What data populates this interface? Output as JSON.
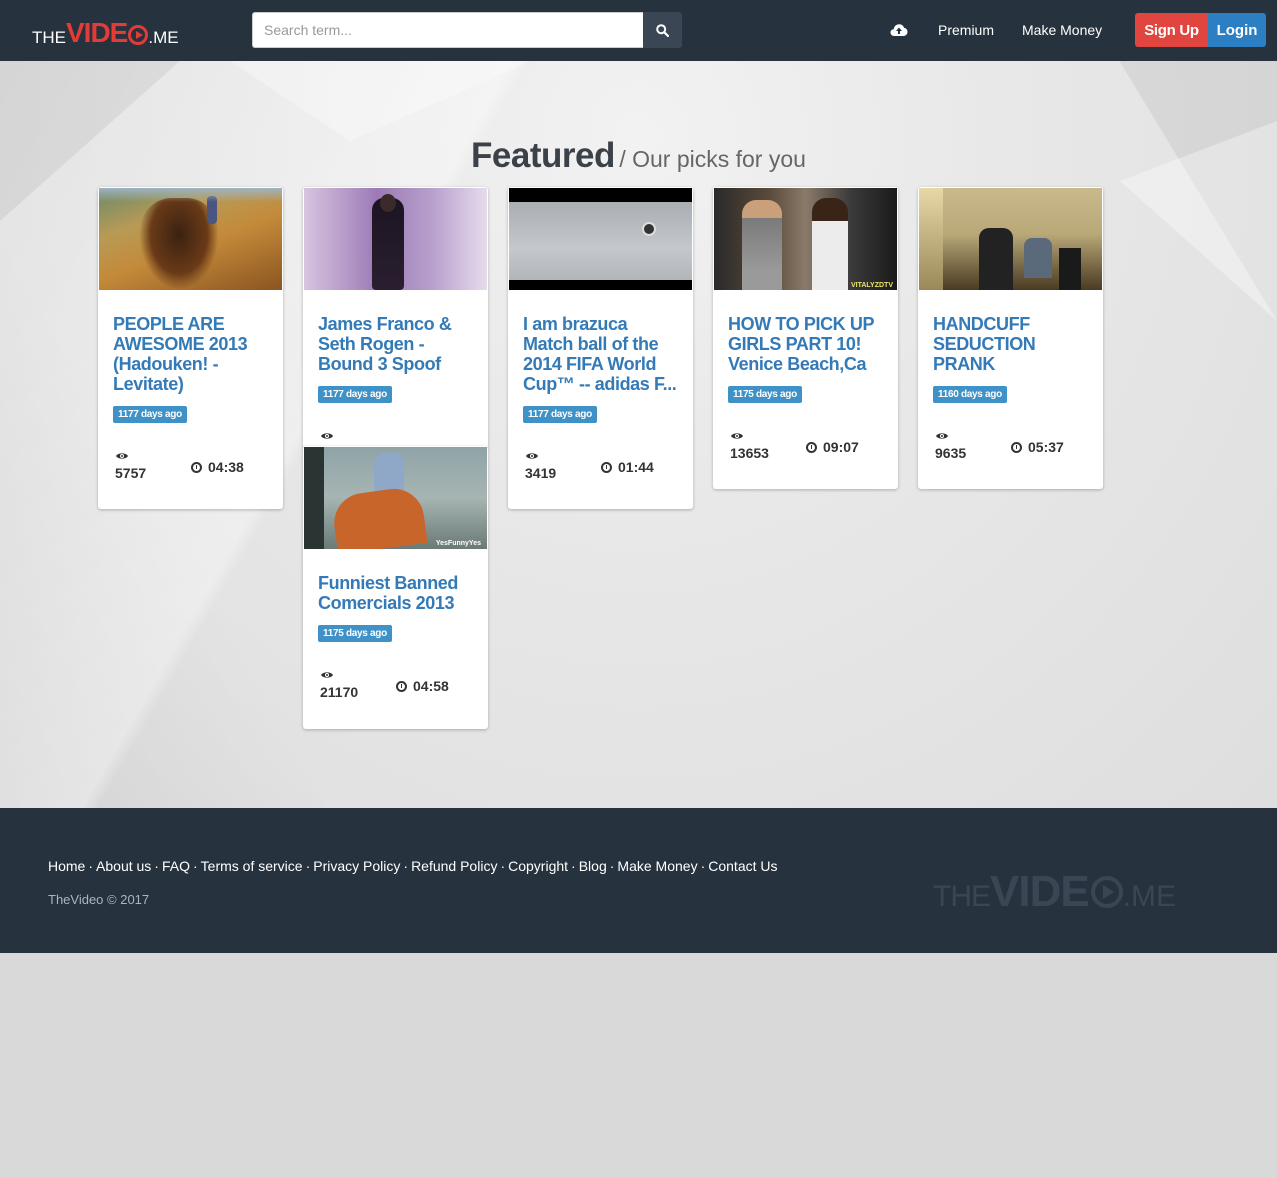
{
  "header": {
    "logo": {
      "the": "THE",
      "video": "VIDE",
      "me": ".ME"
    },
    "search": {
      "placeholder": "Search term..."
    },
    "nav": {
      "premium": "Premium",
      "make_money": "Make Money"
    },
    "auth": {
      "signup": "Sign Up",
      "login": "Login"
    },
    "icons": {
      "upload": "cloud-upload-icon",
      "search": "search-icon"
    }
  },
  "featured": {
    "title": "Featured",
    "subtitle": "/ Our picks for you"
  },
  "videos": [
    {
      "title": "PEOPLE ARE AWESOME 2013 (Hadouken! - Levitate)",
      "age": "1177 days ago",
      "views": "5757",
      "duration": "04:38"
    },
    {
      "title": "James Franco & Seth Rogen - Bound 3 Spoof",
      "age": "1177 days ago",
      "views": "",
      "duration": ""
    },
    {
      "title": "I am brazuca Match ball of the 2014 FIFA World Cup™ -- adidas F...",
      "age": "1177 days ago",
      "views": "3419",
      "duration": "01:44"
    },
    {
      "title": "HOW TO PICK UP GIRLS PART 10! Venice Beach,Ca",
      "age": "1175 days ago",
      "views": "13653",
      "duration": "09:07"
    },
    {
      "title": "HANDCUFF SEDUCTION PRANK",
      "age": "1160 days ago",
      "views": "9635",
      "duration": "05:37"
    },
    {
      "title": "Funniest Banned Comercials 2013",
      "age": "1175 days ago",
      "views": "21170",
      "duration": "04:58",
      "watermark": "YesFunnyYes"
    }
  ],
  "thumb_watermarks": {
    "video4": "VITALYZDTV"
  },
  "footer": {
    "links": [
      "Home",
      "About us",
      "FAQ",
      "Terms of service",
      "Privacy Policy",
      "Refund Policy",
      "Copyright",
      "Blog",
      "Make Money",
      "Contact Us"
    ],
    "separator": "·",
    "copyright": "TheVideo © 2017",
    "logo": {
      "the": "THE",
      "video": "VIDE",
      "me": ".ME"
    }
  },
  "colors": {
    "navbar": "#26323e",
    "signup": "#e0463f",
    "login": "#2c7fc3",
    "link": "#337ab7",
    "badge": "#3f92c7",
    "brand_red": "#e43b36"
  }
}
